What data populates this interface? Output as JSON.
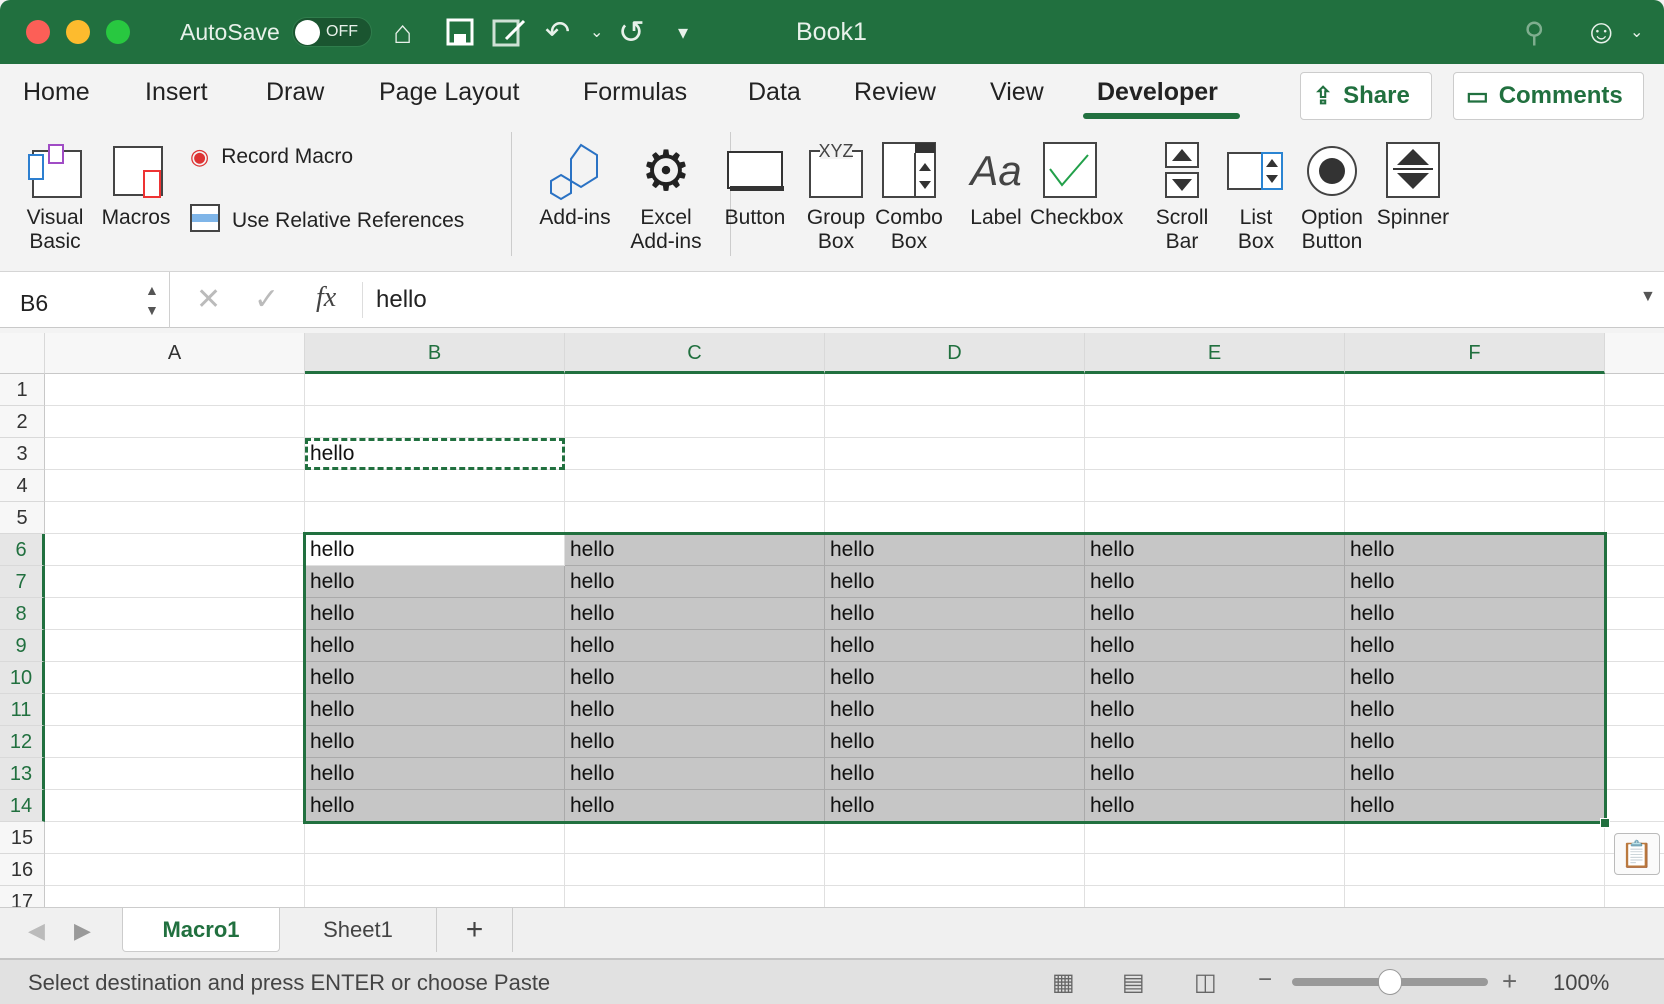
{
  "titlebar": {
    "autosave_label": "AutoSave",
    "autosave_state": "OFF",
    "title": "Book1"
  },
  "tabs": [
    {
      "label": "Home"
    },
    {
      "label": "Insert"
    },
    {
      "label": "Draw"
    },
    {
      "label": "Page Layout"
    },
    {
      "label": "Formulas"
    },
    {
      "label": "Data"
    },
    {
      "label": "Review"
    },
    {
      "label": "View"
    },
    {
      "label": "Developer",
      "active": true
    }
  ],
  "header_buttons": {
    "share": "Share",
    "comments": "Comments"
  },
  "ribbon": {
    "visual_basic": [
      "Visual",
      "Basic"
    ],
    "macros": "Macros",
    "record_macro": "Record Macro",
    "relative_refs": "Use Relative References",
    "addins": "Add-ins",
    "excel_addins": [
      "Excel",
      "Add-ins"
    ],
    "controls": [
      [
        "Button",
        ""
      ],
      [
        "Group",
        "Box"
      ],
      [
        "Combo",
        "Box"
      ],
      [
        "Label",
        ""
      ],
      [
        "Checkbox",
        ""
      ],
      [
        "Scroll",
        "Bar"
      ],
      [
        "List",
        "Box"
      ],
      [
        "Option",
        "Button"
      ],
      [
        "Spinner",
        ""
      ]
    ],
    "group_box_glyph": "XYZ",
    "label_glyph": "Aa"
  },
  "formula_bar": {
    "name_box": "B6",
    "fx": "fx",
    "value": "hello"
  },
  "grid": {
    "columns": [
      "A",
      "B",
      "C",
      "D",
      "E",
      "F"
    ],
    "rows": [
      "1",
      "2",
      "3",
      "4",
      "5",
      "6",
      "7",
      "8",
      "9",
      "10",
      "11",
      "12",
      "13",
      "14",
      "15",
      "16",
      "17"
    ],
    "selected_columns": [
      "B",
      "C",
      "D",
      "E",
      "F"
    ],
    "selected_rows": [
      "6",
      "7",
      "8",
      "9",
      "10",
      "11",
      "12",
      "13",
      "14"
    ],
    "active_cell": "B6",
    "copy_cell": "B3",
    "cells": {
      "B3": "hello"
    },
    "fill_range": {
      "from": "B6",
      "to": "F14",
      "value": "hello"
    }
  },
  "sheets": [
    {
      "label": "Macro1",
      "active": true
    },
    {
      "label": "Sheet1"
    }
  ],
  "add_sheet": "+",
  "status": {
    "message": "Select destination and press ENTER or choose Paste",
    "zoom": "100%",
    "zoom_fraction": 0.5
  },
  "colors": {
    "accent": "#21703f",
    "selection_fill": "#c6c6c6"
  }
}
